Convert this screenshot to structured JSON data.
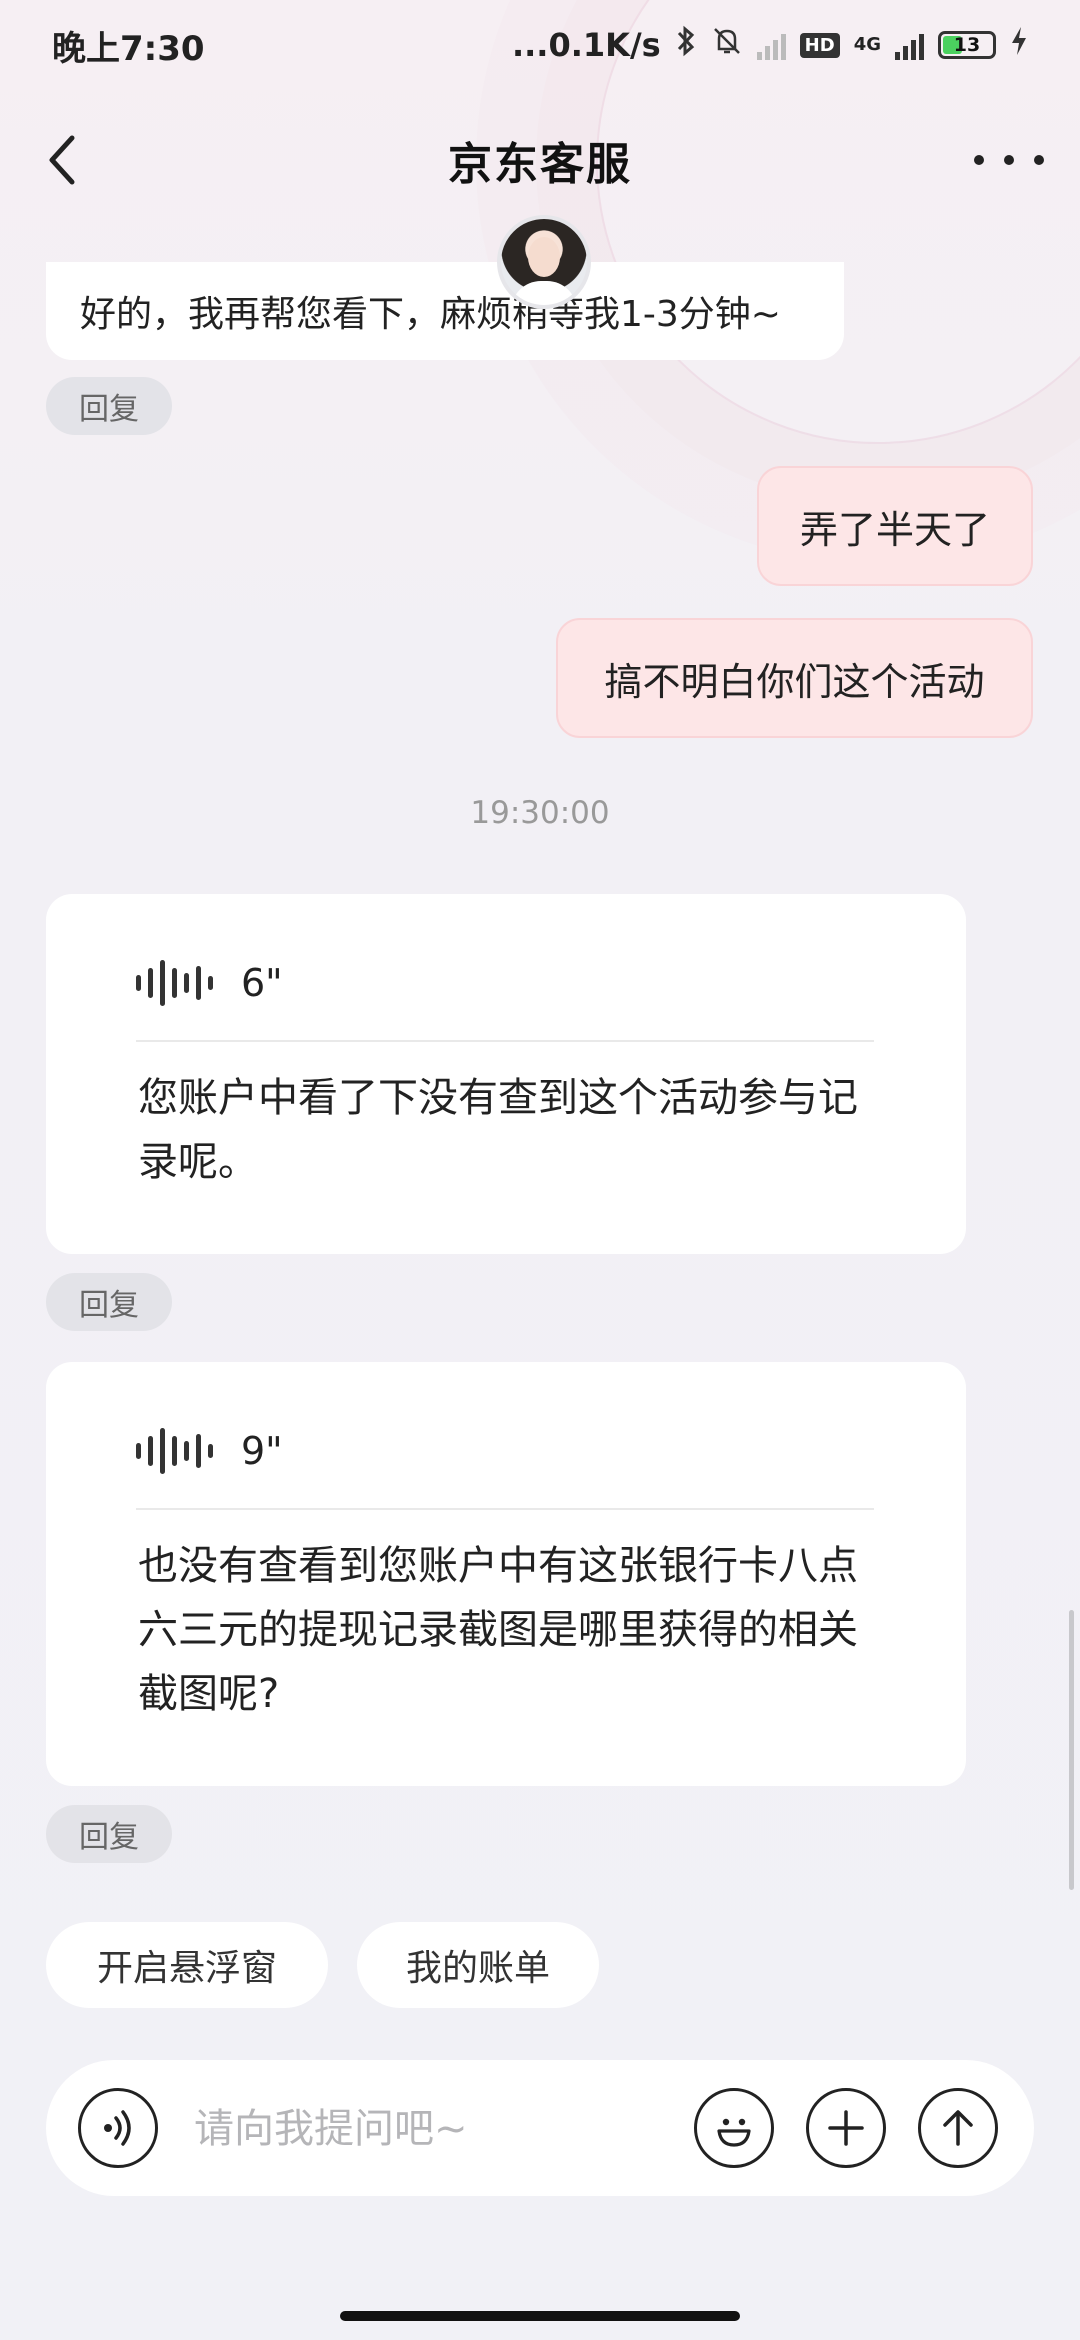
{
  "status_bar": {
    "time": "晚上7:30",
    "network_speed": "...0.1K/s",
    "hd": "HD",
    "network_type": "4G",
    "battery": "13"
  },
  "header": {
    "title": "京东客服"
  },
  "messages": {
    "agent_top": "好的，我再帮您看下，麻烦稍等我1-3分钟~",
    "reply_label": "回复",
    "user_1": "弄了半天了",
    "user_2": "搞不明白你们这个活动",
    "timestamp": "19:30:00",
    "voice_1": {
      "duration": "6\"",
      "transcript": "您账户中看了下没有查到这个活动参与记录呢。"
    },
    "voice_2": {
      "duration": "9\"",
      "transcript": "也没有查看到您账户中有这张银行卡八点六三元的提现记录截图是哪里获得的相关截图呢?"
    }
  },
  "quick_actions": [
    "开启悬浮窗",
    "我的账单"
  ],
  "input": {
    "placeholder": "请向我提问吧~"
  }
}
